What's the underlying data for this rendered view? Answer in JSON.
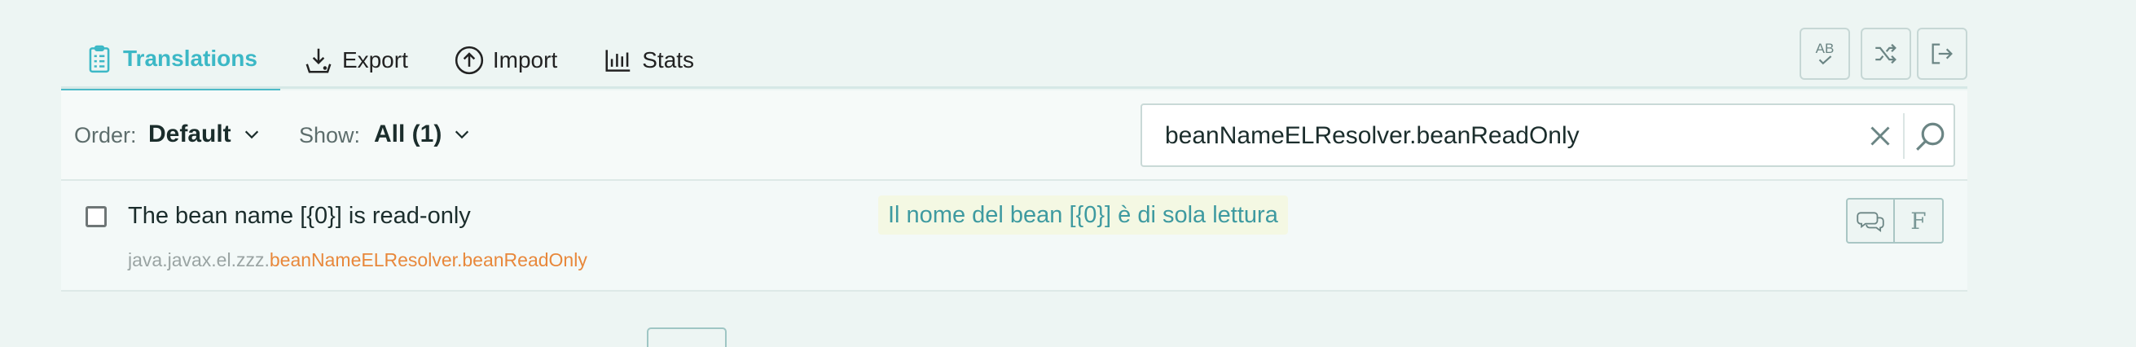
{
  "tabs": [
    {
      "label": "Translations",
      "icon": "clipboard-list-icon",
      "active": true
    },
    {
      "label": "Export",
      "icon": "download-tray-icon",
      "active": false
    },
    {
      "label": "Import",
      "icon": "circle-arrow-up-icon",
      "active": false
    },
    {
      "label": "Stats",
      "icon": "bar-chart-icon",
      "active": false
    }
  ],
  "toolbar": {
    "spellcheck_label": "AB",
    "spellcheck_icon": "spellcheck-icon",
    "shuffle_icon": "shuffle-icon",
    "logout_icon": "sign-out-icon"
  },
  "filter": {
    "order_label": "Order:",
    "order_value": "Default",
    "show_label": "Show:",
    "show_value": "All (1)"
  },
  "search": {
    "value": "beanNameELResolver.beanReadOnly"
  },
  "entries": [
    {
      "source": "The bean name [{0}] is read-only",
      "key_prefix": "java.javax.el.zzz.",
      "key_name": "beanNameELResolver.beanReadOnly",
      "translation": "Il nome del bean [{0}] è di sola lettura",
      "actions": {
        "comment_icon": "comments-icon",
        "flag_glyph": "F"
      }
    }
  ],
  "colors": {
    "accent": "#3cb8c6",
    "key_highlight": "#e8883b",
    "translation_text": "#3e9aa0",
    "background": "#edf5f3"
  }
}
